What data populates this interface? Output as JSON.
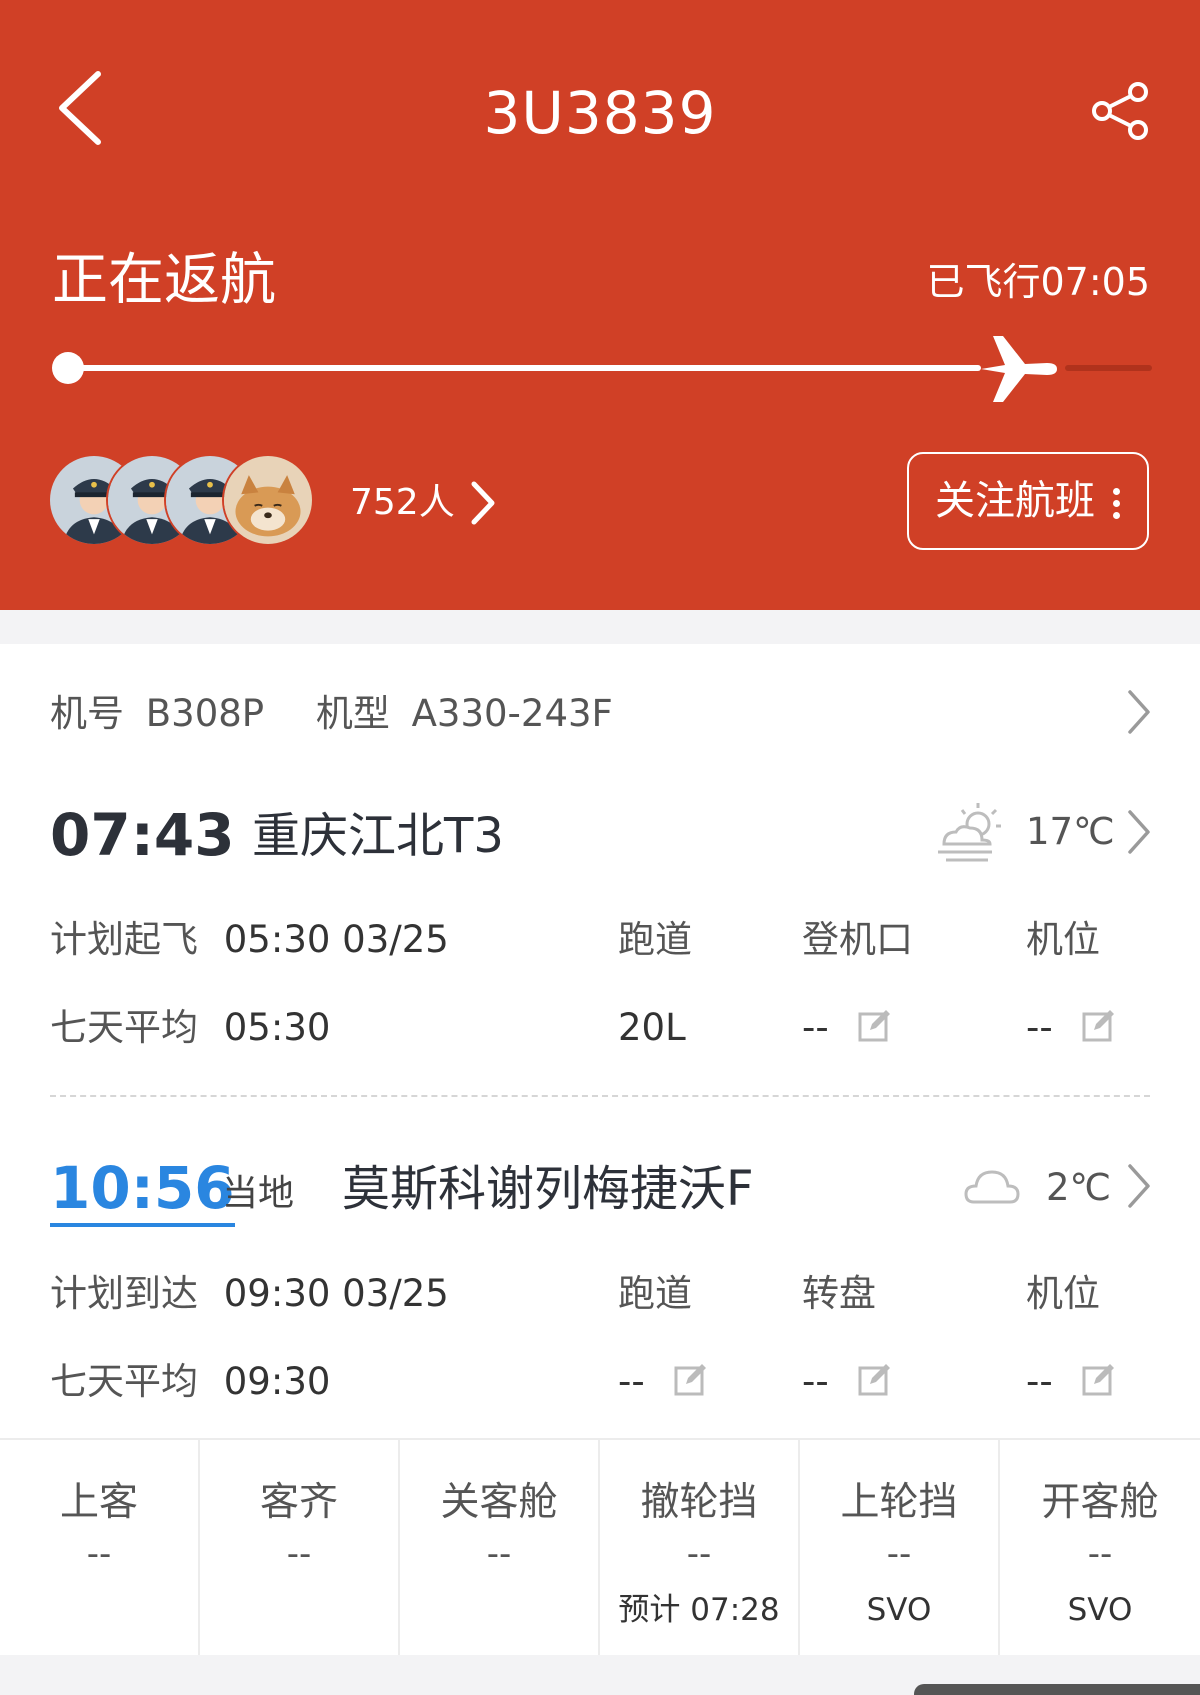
{
  "header": {
    "flight_number": "3U3839",
    "status": "正在返航",
    "flown_time": "已飞行07:05",
    "progress": 0.85,
    "crew_count": "752人",
    "follow_label": "关注航班"
  },
  "aircraft": {
    "reg_label": "机号",
    "reg_value": "B308P",
    "type_label": "机型",
    "type_value": "A330-243F"
  },
  "departure": {
    "time": "07:43",
    "airport": "重庆江北T3",
    "temperature": "17℃",
    "weather_icon": "partly-cloudy-sun-icon",
    "planned_label": "计划起飞",
    "planned_value": "05:30 03/25",
    "avg_label": "七天平均",
    "avg_value": "05:30",
    "col1_label": "跑道",
    "col2_label": "登机口",
    "col3_label": "机位",
    "col1_value": "20L",
    "col2_value": "--",
    "col3_value": "--"
  },
  "arrival": {
    "time": "10:56",
    "local_label": "当地",
    "airport": "莫斯科谢列梅捷沃F",
    "temperature": "2℃",
    "weather_icon": "cloud-icon",
    "planned_label": "计划到达",
    "planned_value": "09:30 03/25",
    "avg_label": "七天平均",
    "avg_value": "09:30",
    "col1_label": "跑道",
    "col2_label": "转盘",
    "col3_label": "机位",
    "col1_value": "--",
    "col2_value": "--",
    "col3_value": "--"
  },
  "milestones": [
    {
      "label": "上客",
      "value": "--",
      "sub": ""
    },
    {
      "label": "客齐",
      "value": "--",
      "sub": ""
    },
    {
      "label": "关客舱",
      "value": "--",
      "sub": ""
    },
    {
      "label": "撤轮挡",
      "value": "--",
      "sub": "预计 07:28"
    },
    {
      "label": "上轮挡",
      "value": "--",
      "sub": "SVO"
    },
    {
      "label": "开客舱",
      "value": "--",
      "sub": "SVO"
    }
  ],
  "colors": {
    "header_bg": "#d04026",
    "link_blue": "#2a86e0"
  }
}
